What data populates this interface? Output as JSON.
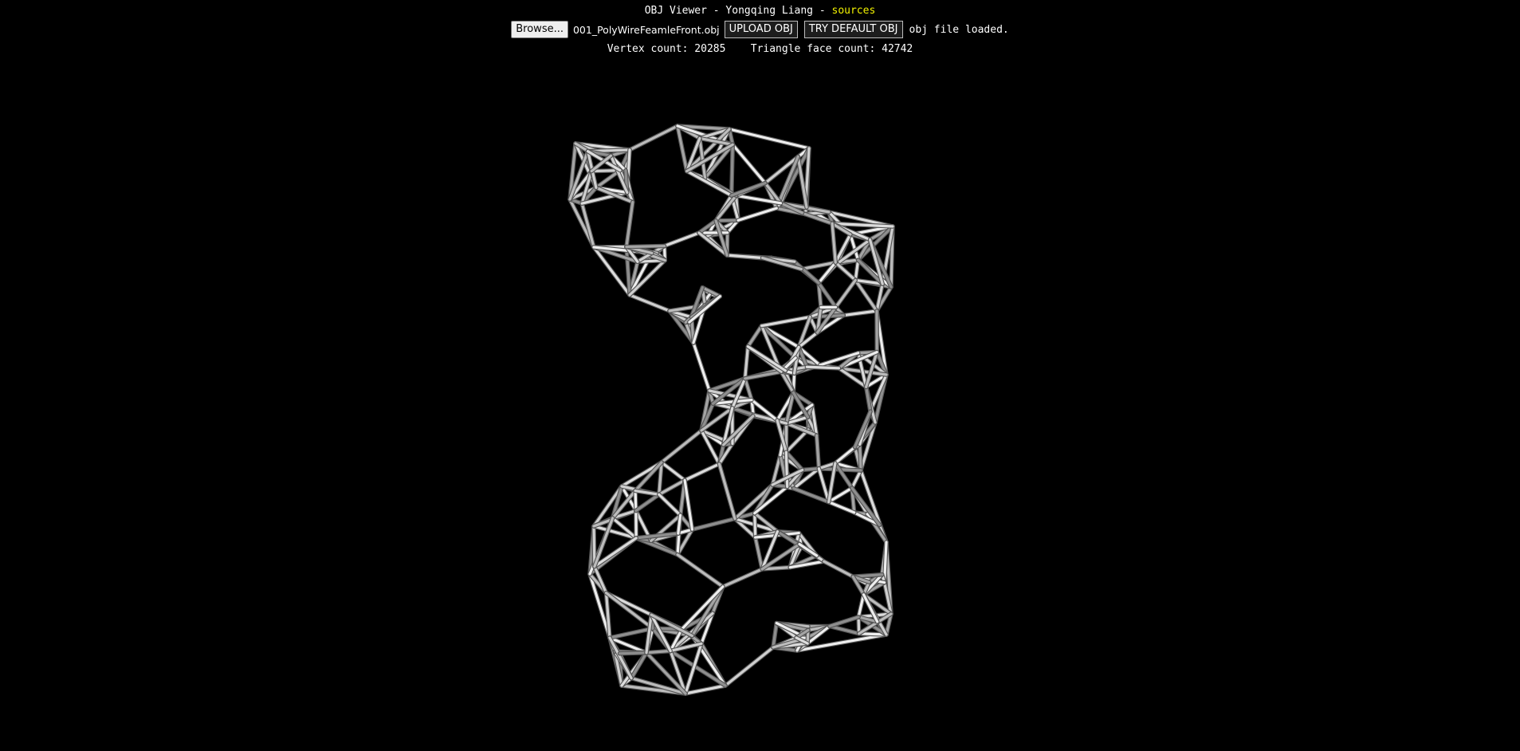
{
  "header": {
    "title_prefix": "OBJ Viewer - Yongqing Liang - ",
    "sources_link": "sources"
  },
  "controls": {
    "browse_label": "Browse...",
    "file_name": "001_PolyWireFeamleFront.obj",
    "upload_label": "UPLOAD OBJ",
    "default_label": "TRY DEFAULT OBJ",
    "status": "obj file loaded."
  },
  "stats": {
    "vertex_label": "Vertex count:",
    "vertex_count": "20285",
    "face_label": "Triangle face count:",
    "face_count": "42742"
  },
  "colors": {
    "background": "#000000",
    "link": "#f2f200",
    "mesh": "#c8c8c8"
  },
  "icons": {
    "model": "wireframe-torso-model"
  }
}
